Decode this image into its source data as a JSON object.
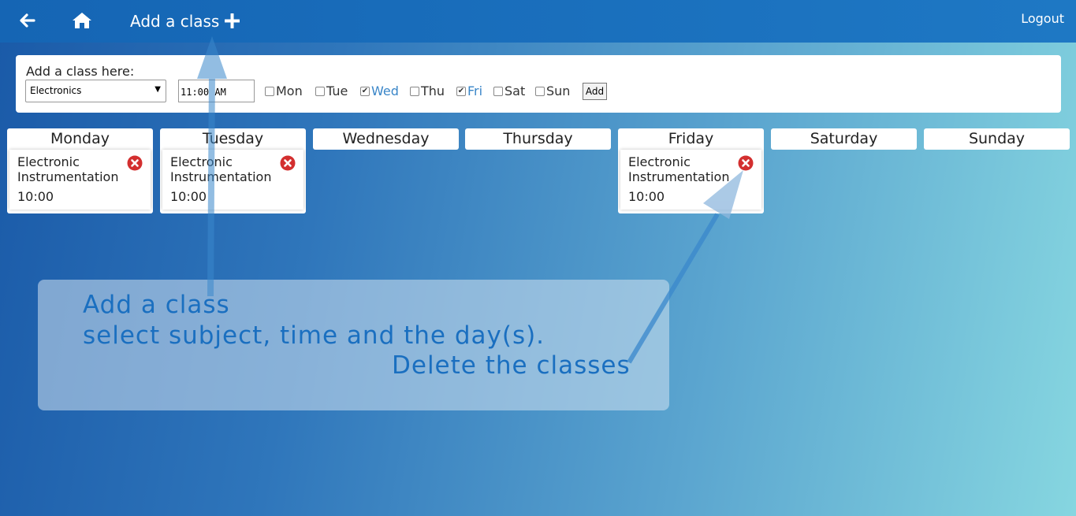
{
  "header": {
    "title": "Add a class",
    "logout": "Logout",
    "back_icon": "arrow-left-icon",
    "home_icon": "home-icon",
    "plus_icon": "plus-icon"
  },
  "add_form": {
    "label": "Add a class here:",
    "subject_selected": "Electronics",
    "time_value": "11:00 AM",
    "days": [
      {
        "label": "Mon",
        "checked": false
      },
      {
        "label": "Tue",
        "checked": false
      },
      {
        "label": "Wed",
        "checked": true
      },
      {
        "label": "Thu",
        "checked": false
      },
      {
        "label": "Fri",
        "checked": true
      },
      {
        "label": "Sat",
        "checked": false
      },
      {
        "label": "Sun",
        "checked": false
      }
    ],
    "add_button": "Add"
  },
  "week": [
    {
      "day": "Monday",
      "classes": [
        {
          "name": "Electronic Instrumentation",
          "time": "10:00"
        }
      ]
    },
    {
      "day": "Tuesday",
      "classes": [
        {
          "name": "Electronic Instrumentation",
          "time": "10:00"
        }
      ]
    },
    {
      "day": "Wednesday",
      "classes": []
    },
    {
      "day": "Thursday",
      "classes": []
    },
    {
      "day": "Friday",
      "classes": [
        {
          "name": "Electronic Instrumentation",
          "time": "10:00"
        }
      ]
    },
    {
      "day": "Saturday",
      "classes": []
    },
    {
      "day": "Sunday",
      "classes": []
    }
  ],
  "tip": {
    "line1": "Add a class",
    "line2": "select subject, time and the day(s).",
    "line3": "Delete the classes"
  },
  "colors": {
    "accent": "#1e78c4",
    "checked_label": "#3a86c8",
    "delete": "#d32f2f",
    "tip_text": "#1a6fc0"
  }
}
